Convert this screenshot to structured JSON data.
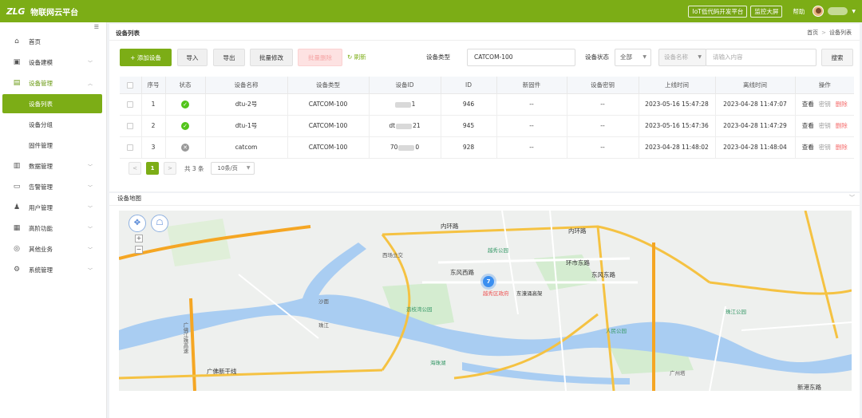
{
  "topbar": {
    "logo_mark": "ZLG",
    "app_name": "物联网云平台",
    "buttons": [
      "IoT低代码开发平台",
      "监控大屏"
    ],
    "help": "帮助",
    "brand_color": "#7cad16"
  },
  "sidebar": {
    "collapse_icon": "☰",
    "items": [
      {
        "label": "首页",
        "icon": "home-icon"
      },
      {
        "label": "设备建模",
        "icon": "model-icon"
      },
      {
        "label": "设备管理",
        "icon": "device-icon"
      },
      {
        "label": "设备列表"
      },
      {
        "label": "设备分组"
      },
      {
        "label": "固件管理"
      },
      {
        "label": "数据管理",
        "icon": "chart-icon"
      },
      {
        "label": "告警管理",
        "icon": "alarm-icon"
      },
      {
        "label": "用户管理",
        "icon": "user-icon"
      },
      {
        "label": "高阶功能",
        "icon": "toolbox-icon"
      },
      {
        "label": "其他业务",
        "icon": "business-icon"
      },
      {
        "label": "系统管理",
        "icon": "settings-icon"
      }
    ]
  },
  "page": {
    "title": "设备列表",
    "breadcrumb": [
      "首页",
      "设备列表"
    ]
  },
  "toolbar": {
    "add": "+ 添加设备",
    "import": "导入",
    "export": "导出",
    "batch_edit": "批量修改",
    "batch_delete": "批量删除",
    "refresh": "刷新",
    "device_type_label": "设备类型",
    "device_type_value": "CATCOM-100",
    "status_label": "设备状态",
    "status_value": "全部",
    "search_field": "设备名称",
    "search_placeholder": "请输入内容",
    "search_button": "搜索"
  },
  "table": {
    "columns": [
      "序号",
      "状态",
      "设备名称",
      "设备类型",
      "设备ID",
      "ID",
      "新固件",
      "设备密钥",
      "上线时间",
      "离线时间",
      "操作"
    ],
    "rows": [
      {
        "index": "1",
        "status": "online",
        "name": "dtu-2号",
        "type": "CATCOM-100",
        "device_id_prefix": "",
        "device_id_suffix": "1",
        "id": "946",
        "firmware": "--",
        "secret": "--",
        "online_time": "2023-05-16 15:47:28",
        "offline_time": "2023-04-28 11:47:07"
      },
      {
        "index": "2",
        "status": "online",
        "name": "dtu-1号",
        "type": "CATCOM-100",
        "device_id_prefix": "dt",
        "device_id_suffix": "21",
        "id": "945",
        "firmware": "--",
        "secret": "--",
        "online_time": "2023-05-16 15:47:36",
        "offline_time": "2023-04-28 11:47:29"
      },
      {
        "index": "3",
        "status": "offline",
        "name": "catcom",
        "type": "CATCOM-100",
        "device_id_prefix": "70",
        "device_id_suffix": "0",
        "id": "928",
        "firmware": "--",
        "secret": "--",
        "online_time": "2023-04-28 11:48:02",
        "offline_time": "2023-04-28 11:48:04"
      }
    ],
    "actions": {
      "view": "查看",
      "key": "密钥",
      "delete": "删除"
    }
  },
  "pagination": {
    "prev": "<",
    "current": "1",
    "next": ">",
    "total": "共 3 条",
    "page_size": "10条/页"
  },
  "map": {
    "title": "设备地图",
    "cluster_count": "7",
    "labels": {
      "r_huanshi": "内环路",
      "r_huanshi2": "内环路",
      "r_dongfeng_w": "东风西路",
      "r_dongfeng_e": "东风东路",
      "r_huanshi_e": "环市东路",
      "r_dongbei": "东濠涌高架",
      "r_xinggang": "新港东路",
      "r_guangfo": "广佛新干线",
      "r_huangsha": "珠江公园",
      "p_yuexiu": "越秀区政府",
      "p_yuexiu_park": "越秀公园",
      "p_huangjin": "荔枝湾公园",
      "p_guangzhou_tower": "广州塔",
      "p_haizhu": "海珠湖",
      "p_zhujiang": "珠江",
      "p_guangfo": "广佛江珠高速",
      "p_shamian": "沙面",
      "p_xiguan": "西场立交",
      "p_renmin": "人民公园"
    }
  }
}
